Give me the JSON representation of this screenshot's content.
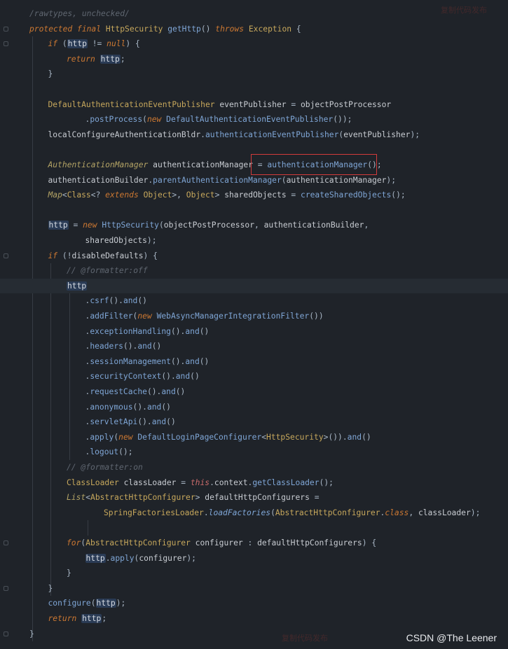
{
  "editor": {
    "lines": [
      {
        "indent": 0,
        "tokens": [
          [
            "cmt",
            "/rawtypes, unchecked/"
          ]
        ]
      },
      {
        "indent": 0,
        "tokens": [
          [
            "kw",
            "protected final "
          ],
          [
            "typ",
            "HttpSecurity "
          ],
          [
            "fn",
            "getHttp"
          ],
          [
            "p",
            "() "
          ],
          [
            "kw",
            "throws "
          ],
          [
            "typ",
            "Exception "
          ],
          [
            "p",
            "{"
          ]
        ]
      },
      {
        "indent": 1,
        "tokens": [
          [
            "kw",
            "if "
          ],
          [
            "p",
            "("
          ],
          [
            "hlv",
            "http"
          ],
          [
            "p",
            " != "
          ],
          [
            "nul",
            "null"
          ],
          [
            "p",
            ") {"
          ]
        ]
      },
      {
        "indent": 2,
        "tokens": [
          [
            "kw",
            "return "
          ],
          [
            "hlv",
            "http"
          ],
          [
            "p",
            ";"
          ]
        ]
      },
      {
        "indent": 1,
        "tokens": [
          [
            "p",
            "}"
          ]
        ]
      },
      {
        "indent": 0,
        "tokens": []
      },
      {
        "indent": 1,
        "tokens": [
          [
            "typ",
            "DefaultAuthenticationEventPublisher "
          ],
          [
            "var",
            "eventPublisher"
          ],
          [
            "p",
            " = "
          ],
          [
            "var",
            "objectPostProcessor"
          ]
        ]
      },
      {
        "indent": 3,
        "tokens": [
          [
            "p",
            "."
          ],
          [
            "fn",
            "postProcess"
          ],
          [
            "p",
            "("
          ],
          [
            "kw",
            "new "
          ],
          [
            "fn",
            "DefaultAuthenticationEventPublisher"
          ],
          [
            "p",
            "());"
          ]
        ]
      },
      {
        "indent": 1,
        "tokens": [
          [
            "var",
            "localConfigureAuthenticationBldr"
          ],
          [
            "p",
            "."
          ],
          [
            "fn",
            "authenticationEventPublisher"
          ],
          [
            "p",
            "("
          ],
          [
            "var",
            "eventPublisher"
          ],
          [
            "p",
            ");"
          ]
        ]
      },
      {
        "indent": 0,
        "tokens": []
      },
      {
        "indent": 1,
        "tokens": [
          [
            "typi",
            "AuthenticationManager "
          ],
          [
            "var",
            "authenticationManager "
          ],
          [
            "p",
            "= "
          ],
          [
            "fn",
            "authenticationManager"
          ],
          [
            "p",
            "();"
          ]
        ]
      },
      {
        "indent": 1,
        "tokens": [
          [
            "var",
            "authenticationBuilder"
          ],
          [
            "p",
            "."
          ],
          [
            "fn",
            "parentAuthenticationManager"
          ],
          [
            "p",
            "("
          ],
          [
            "var",
            "authenticationManager"
          ],
          [
            "p",
            ");"
          ]
        ]
      },
      {
        "indent": 1,
        "tokens": [
          [
            "typi",
            "Map"
          ],
          [
            "p",
            "<"
          ],
          [
            "typ",
            "Class"
          ],
          [
            "p",
            "<? "
          ],
          [
            "kw",
            "extends "
          ],
          [
            "typ",
            "Object"
          ],
          [
            "p",
            ">, "
          ],
          [
            "typ",
            "Object"
          ],
          [
            "p",
            "> "
          ],
          [
            "var",
            "sharedObjects"
          ],
          [
            "p",
            " = "
          ],
          [
            "fn",
            "createSharedObjects"
          ],
          [
            "p",
            "();"
          ]
        ]
      },
      {
        "indent": 0,
        "tokens": []
      },
      {
        "indent": 1,
        "tokens": [
          [
            "hlv",
            "http"
          ],
          [
            "p",
            " = "
          ],
          [
            "kw",
            "new "
          ],
          [
            "fn",
            "HttpSecurity"
          ],
          [
            "p",
            "("
          ],
          [
            "var",
            "objectPostProcessor"
          ],
          [
            "p",
            ", "
          ],
          [
            "var",
            "authenticationBuilder"
          ],
          [
            "p",
            ","
          ]
        ]
      },
      {
        "indent": 3,
        "tokens": [
          [
            "var",
            "sharedObjects"
          ],
          [
            "p",
            ");"
          ]
        ]
      },
      {
        "indent": 1,
        "tokens": [
          [
            "kw",
            "if "
          ],
          [
            "p",
            "(!"
          ],
          [
            "var",
            "disableDefaults"
          ],
          [
            "p",
            ") {"
          ]
        ]
      },
      {
        "indent": 2,
        "tokens": [
          [
            "cmt",
            "// @formatter:off"
          ]
        ]
      },
      {
        "indent": 2,
        "tokens": [
          [
            "hlv",
            "http"
          ]
        ]
      },
      {
        "indent": 3,
        "tokens": [
          [
            "p",
            "."
          ],
          [
            "fn",
            "csrf"
          ],
          [
            "p",
            "()."
          ],
          [
            "fn",
            "and"
          ],
          [
            "p",
            "()"
          ]
        ]
      },
      {
        "indent": 3,
        "tokens": [
          [
            "p",
            "."
          ],
          [
            "fn",
            "addFilter"
          ],
          [
            "p",
            "("
          ],
          [
            "kw",
            "new "
          ],
          [
            "fn",
            "WebAsyncManagerIntegrationFilter"
          ],
          [
            "p",
            "())"
          ]
        ]
      },
      {
        "indent": 3,
        "tokens": [
          [
            "p",
            "."
          ],
          [
            "fn",
            "exceptionHandling"
          ],
          [
            "p",
            "()."
          ],
          [
            "fn",
            "and"
          ],
          [
            "p",
            "()"
          ]
        ]
      },
      {
        "indent": 3,
        "tokens": [
          [
            "p",
            "."
          ],
          [
            "fn",
            "headers"
          ],
          [
            "p",
            "()."
          ],
          [
            "fn",
            "and"
          ],
          [
            "p",
            "()"
          ]
        ]
      },
      {
        "indent": 3,
        "tokens": [
          [
            "p",
            "."
          ],
          [
            "fn",
            "sessionManagement"
          ],
          [
            "p",
            "()."
          ],
          [
            "fn",
            "and"
          ],
          [
            "p",
            "()"
          ]
        ]
      },
      {
        "indent": 3,
        "tokens": [
          [
            "p",
            "."
          ],
          [
            "fn",
            "securityContext"
          ],
          [
            "p",
            "()."
          ],
          [
            "fn",
            "and"
          ],
          [
            "p",
            "()"
          ]
        ]
      },
      {
        "indent": 3,
        "tokens": [
          [
            "p",
            "."
          ],
          [
            "fn",
            "requestCache"
          ],
          [
            "p",
            "()."
          ],
          [
            "fn",
            "and"
          ],
          [
            "p",
            "()"
          ]
        ]
      },
      {
        "indent": 3,
        "tokens": [
          [
            "p",
            "."
          ],
          [
            "fn",
            "anonymous"
          ],
          [
            "p",
            "()."
          ],
          [
            "fn",
            "and"
          ],
          [
            "p",
            "()"
          ]
        ]
      },
      {
        "indent": 3,
        "tokens": [
          [
            "p",
            "."
          ],
          [
            "fn",
            "servletApi"
          ],
          [
            "p",
            "()."
          ],
          [
            "fn",
            "and"
          ],
          [
            "p",
            "()"
          ]
        ]
      },
      {
        "indent": 3,
        "tokens": [
          [
            "p",
            "."
          ],
          [
            "fn",
            "apply"
          ],
          [
            "p",
            "("
          ],
          [
            "kw",
            "new "
          ],
          [
            "fn",
            "DefaultLoginPageConfigurer"
          ],
          [
            "p",
            "<"
          ],
          [
            "typ",
            "HttpSecurity"
          ],
          [
            "p",
            ">())."
          ],
          [
            "fn",
            "and"
          ],
          [
            "p",
            "()"
          ]
        ]
      },
      {
        "indent": 3,
        "tokens": [
          [
            "p",
            "."
          ],
          [
            "fn",
            "logout"
          ],
          [
            "p",
            "();"
          ]
        ]
      },
      {
        "indent": 2,
        "tokens": [
          [
            "cmt",
            "// @formatter:on"
          ]
        ]
      },
      {
        "indent": 2,
        "tokens": [
          [
            "typ",
            "ClassLoader "
          ],
          [
            "var",
            "classLoader"
          ],
          [
            "p",
            " = "
          ],
          [
            "this",
            "this"
          ],
          [
            "p",
            "."
          ],
          [
            "var",
            "context"
          ],
          [
            "p",
            "."
          ],
          [
            "fn",
            "getClassLoader"
          ],
          [
            "p",
            "();"
          ]
        ]
      },
      {
        "indent": 2,
        "tokens": [
          [
            "typi",
            "List"
          ],
          [
            "p",
            "<"
          ],
          [
            "typ",
            "AbstractHttpConfigurer"
          ],
          [
            "p",
            "> "
          ],
          [
            "var",
            "defaultHttpConfigurers"
          ],
          [
            "p",
            " ="
          ]
        ]
      },
      {
        "indent": 4,
        "tokens": [
          [
            "typ",
            "SpringFactoriesLoader"
          ],
          [
            "p",
            "."
          ],
          [
            "fni",
            "loadFactories"
          ],
          [
            "p",
            "("
          ],
          [
            "typ",
            "AbstractHttpConfigurer"
          ],
          [
            "p",
            "."
          ],
          [
            "kw",
            "class"
          ],
          [
            "p",
            ", "
          ],
          [
            "var",
            "classLoader"
          ],
          [
            "p",
            ");"
          ]
        ]
      },
      {
        "indent": 0,
        "tokens": []
      },
      {
        "indent": 2,
        "tokens": [
          [
            "kw",
            "for"
          ],
          [
            "p",
            "("
          ],
          [
            "typ",
            "AbstractHttpConfigurer "
          ],
          [
            "var",
            "configurer"
          ],
          [
            "p",
            " : "
          ],
          [
            "var",
            "defaultHttpConfigurers"
          ],
          [
            "p",
            ") {"
          ]
        ]
      },
      {
        "indent": 3,
        "tokens": [
          [
            "hlv",
            "http"
          ],
          [
            "p",
            "."
          ],
          [
            "fn",
            "apply"
          ],
          [
            "p",
            "("
          ],
          [
            "var",
            "configurer"
          ],
          [
            "p",
            ");"
          ]
        ]
      },
      {
        "indent": 2,
        "tokens": [
          [
            "p",
            "}"
          ]
        ]
      },
      {
        "indent": 1,
        "tokens": [
          [
            "p",
            "}"
          ]
        ]
      },
      {
        "indent": 1,
        "tokens": [
          [
            "fn",
            "configure"
          ],
          [
            "p",
            "("
          ],
          [
            "hlv",
            "http"
          ],
          [
            "p",
            ");"
          ]
        ]
      },
      {
        "indent": 1,
        "tokens": [
          [
            "kw",
            "return "
          ],
          [
            "hlv",
            "http"
          ],
          [
            "p",
            ";"
          ]
        ]
      },
      {
        "indent": 0,
        "tokens": [
          [
            "p",
            "}"
          ]
        ]
      }
    ]
  },
  "watermark": "CSDN @The Leener",
  "ghost_watermark_top": "复制代码发布",
  "ghost_watermark_bottom": "复制代码发布",
  "colors": {
    "background": "#1f2329",
    "highlight_row": "#262c33",
    "annotation_box": "#d23b3b"
  }
}
